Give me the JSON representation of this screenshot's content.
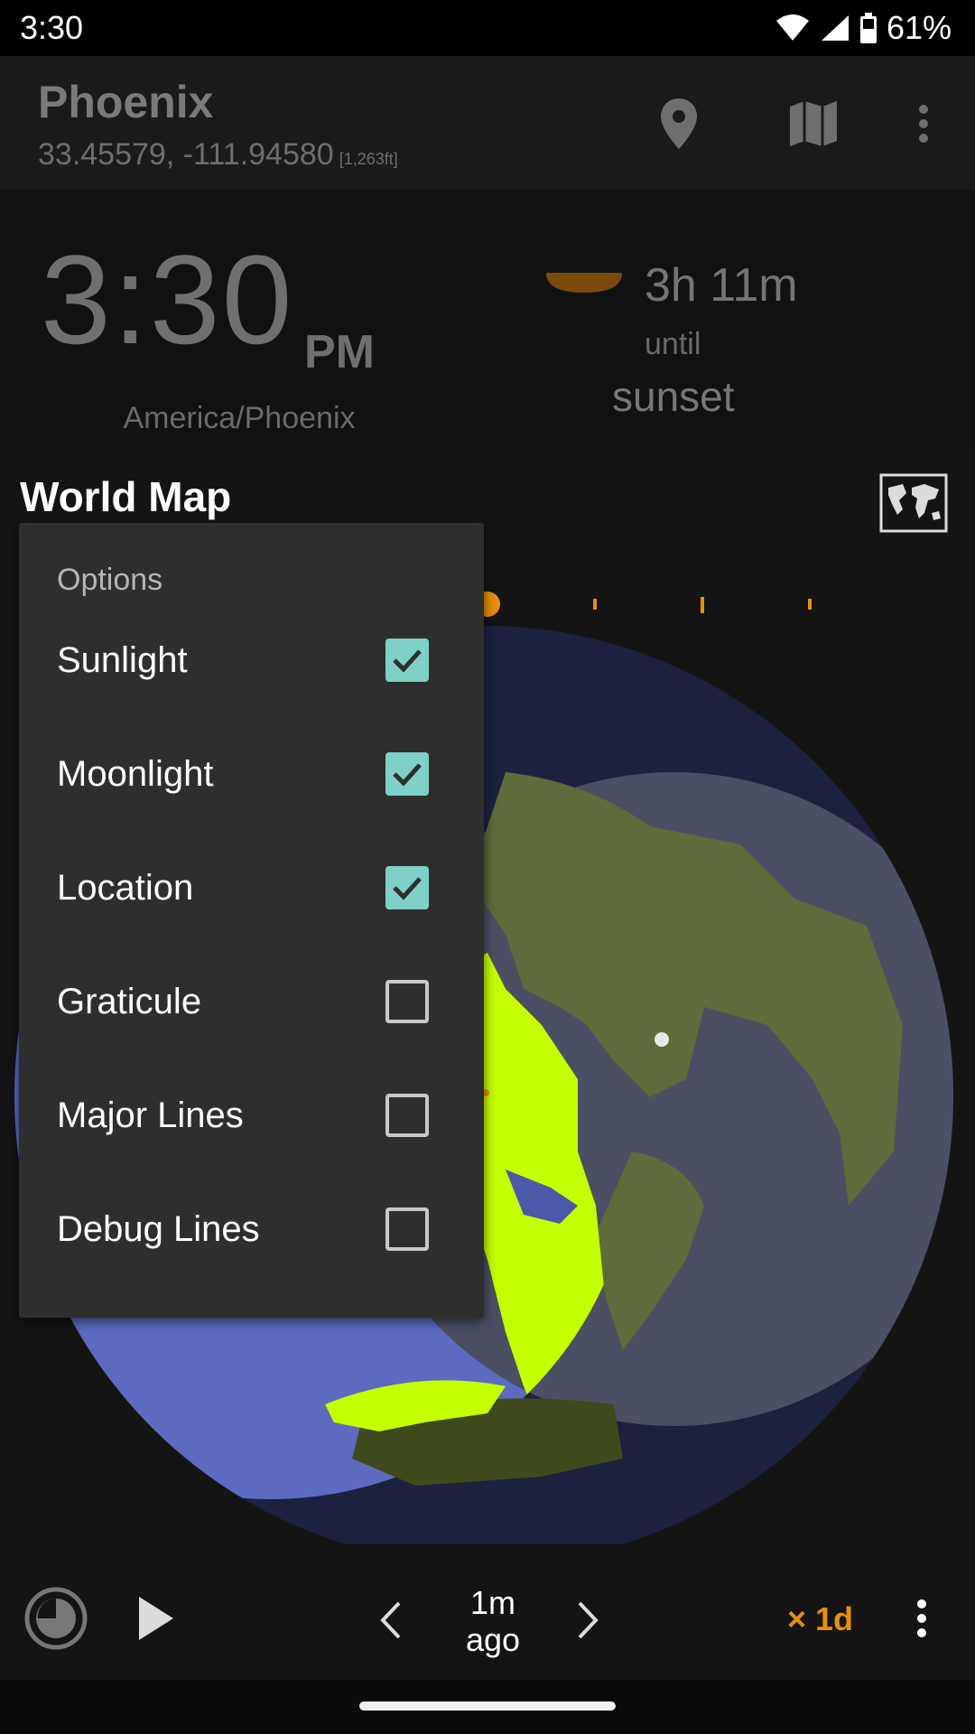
{
  "status_bar": {
    "time": "3:30",
    "battery": "61%"
  },
  "location": {
    "name": "Phoenix",
    "coords": "33.45579, -111.94580",
    "elevation": "[1,263ft]"
  },
  "clock": {
    "time": "3:30",
    "ampm": "PM",
    "timezone": "America/Phoenix"
  },
  "sun": {
    "duration": "3h 11m",
    "until": "until",
    "event": "sunset"
  },
  "map": {
    "title": "World Map"
  },
  "options_menu": {
    "header": "Options",
    "items": [
      {
        "label": "Sunlight",
        "checked": true
      },
      {
        "label": "Moonlight",
        "checked": true
      },
      {
        "label": "Location",
        "checked": true
      },
      {
        "label": "Graticule",
        "checked": false
      },
      {
        "label": "Major Lines",
        "checked": false
      },
      {
        "label": "Debug Lines",
        "checked": false
      }
    ]
  },
  "bottom_bar": {
    "offset_line1": "1m",
    "offset_line2": "ago",
    "speed": "× 1d"
  },
  "colors": {
    "accent": "#e8900a",
    "checkbox_on": "#7fd1c7",
    "globe_ocean": "#5c6bc0",
    "sunlit_land": "#c6ff00",
    "dark_land": "#5e6b3a"
  },
  "icons": [
    "wifi-icon",
    "signal-icon",
    "battery-icon",
    "location-pin-icon",
    "map-icon",
    "overflow-menu-icon",
    "world-map-icon",
    "time-reset-icon",
    "play-icon",
    "chevron-left-icon",
    "chevron-right-icon"
  ]
}
